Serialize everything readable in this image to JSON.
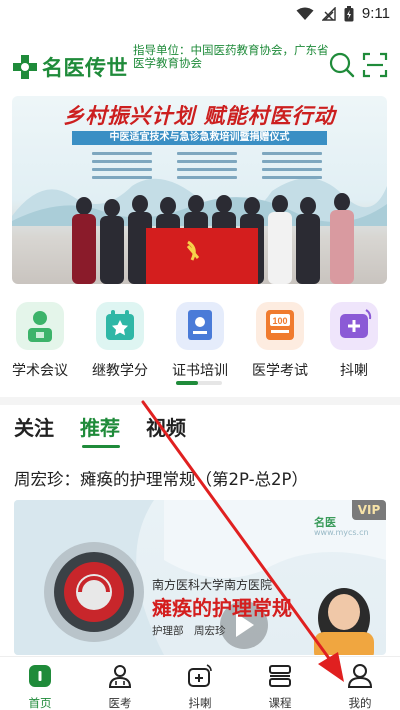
{
  "status_bar": {
    "time": "9:11"
  },
  "header": {
    "logo_text": "名医传世",
    "sponsor": "指导单位：中国医药教育协会，广东省医学教育协会",
    "search_icon": "search-icon",
    "scan_icon": "scan-icon"
  },
  "banner": {
    "title": "乡村振兴计划 赋能村医行动",
    "subtitle": "中医适宜技术与急诊急救培训暨捐赠仪式"
  },
  "categories": [
    {
      "label": "学术会议",
      "icon": "meeting-icon",
      "color": "#3db36a"
    },
    {
      "label": "继教学分",
      "icon": "credit-icon",
      "color": "#2fb7a6"
    },
    {
      "label": "证书培训",
      "icon": "certificate-icon",
      "color": "#4a7bd8"
    },
    {
      "label": "医学考试",
      "icon": "exam-icon",
      "color": "#f07b2e"
    },
    {
      "label": "抖喇",
      "icon": "video-icon",
      "color": "#8b5ad6"
    }
  ],
  "tabs": [
    {
      "label": "关注",
      "active": false
    },
    {
      "label": "推荐",
      "active": true
    },
    {
      "label": "视频",
      "active": false
    }
  ],
  "feed": {
    "article_title": "周宏珍：瘫痪的护理常规（第2P-总2P）",
    "video": {
      "badge": "VIP",
      "hospital": "南方医科大学南方医院",
      "topic": "瘫痪的护理常规",
      "presenter": "护理部　周宏珍",
      "logo": "名医",
      "url": "www.mycs.cn"
    }
  },
  "bottom_nav": [
    {
      "label": "首页",
      "icon": "home-icon",
      "active": true
    },
    {
      "label": "医考",
      "icon": "doctor-icon",
      "active": false
    },
    {
      "label": "抖喇",
      "icon": "video-add-icon",
      "active": false
    },
    {
      "label": "课程",
      "icon": "course-icon",
      "active": false
    },
    {
      "label": "我的",
      "icon": "profile-icon",
      "active": false
    }
  ],
  "colors": {
    "brand": "#1f8b3a",
    "accent_red": "#d41e1e"
  }
}
